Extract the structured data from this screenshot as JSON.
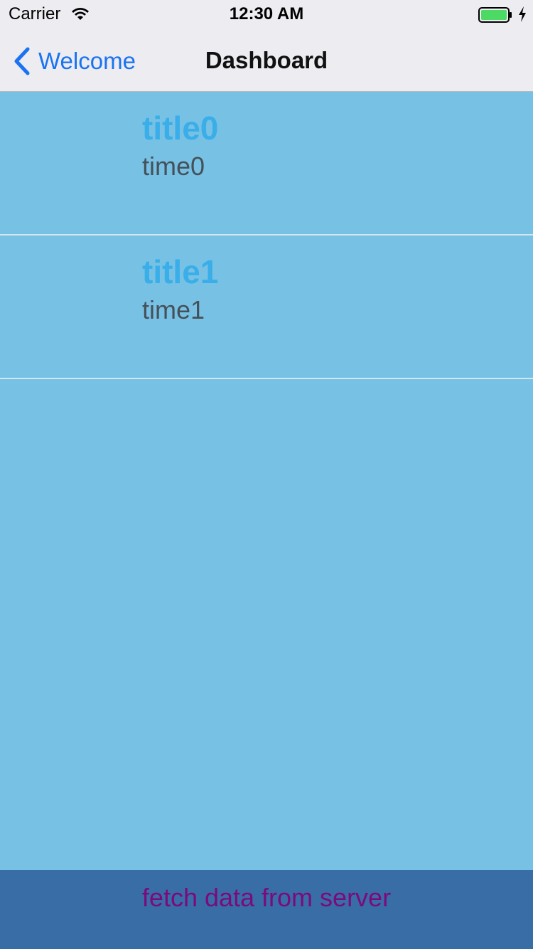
{
  "status_bar": {
    "carrier": "Carrier",
    "time": "12:30 AM",
    "wifi_icon": "wifi-icon",
    "battery_icon": "battery-icon",
    "battery_color": "#4cd964"
  },
  "nav": {
    "back_label": "Welcome",
    "title": "Dashboard",
    "tint_color": "#1a73f0"
  },
  "list": {
    "items": [
      {
        "title": "title0",
        "time": "time0"
      },
      {
        "title": "title1",
        "time": "time1"
      }
    ]
  },
  "footer": {
    "fetch_label": "fetch data from server",
    "background": "#386ea5",
    "text_color": "#7c0a7f"
  }
}
